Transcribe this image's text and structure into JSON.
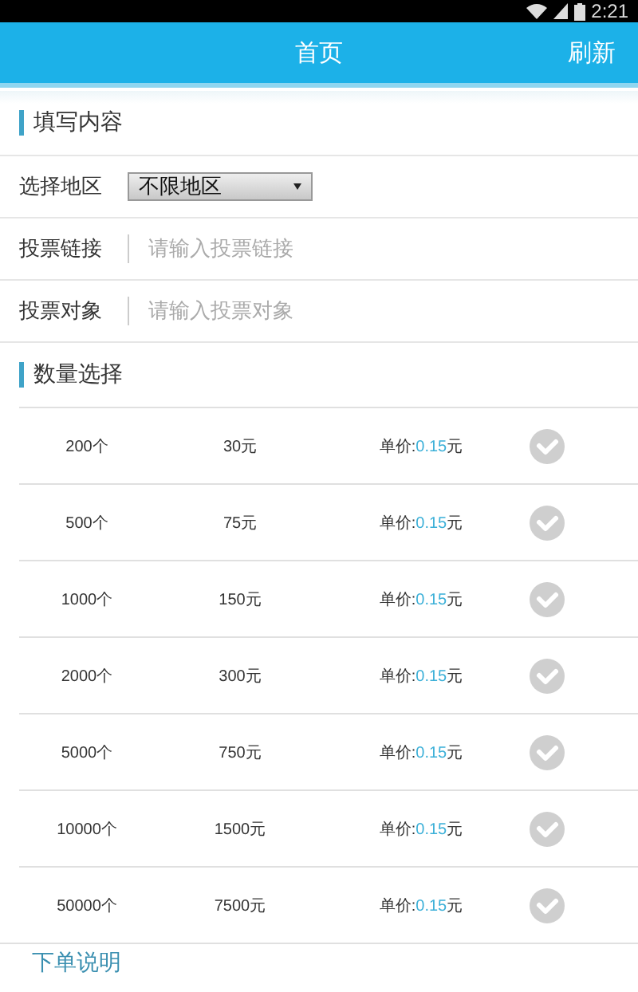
{
  "status_bar": {
    "time": "2:21"
  },
  "app_bar": {
    "title": "首页",
    "action": "刷新"
  },
  "form_section": {
    "title": "填写内容",
    "rows": [
      {
        "kind": "select",
        "label": "选择地区",
        "value": "不限地区"
      },
      {
        "kind": "input",
        "label": "投票链接",
        "placeholder": "请输入投票链接"
      },
      {
        "kind": "input",
        "label": "投票对象",
        "placeholder": "请输入投票对象"
      }
    ]
  },
  "quantity_section": {
    "title": "数量选择",
    "options": [
      {
        "count": "200个",
        "total": "30元",
        "price_label": "单价:",
        "unit_price": "0.15",
        "price_unit": "元",
        "selected": false
      },
      {
        "count": "500个",
        "total": "75元",
        "price_label": "单价:",
        "unit_price": "0.15",
        "price_unit": "元",
        "selected": false
      },
      {
        "count": "1000个",
        "total": "150元",
        "price_label": "单价:",
        "unit_price": "0.15",
        "price_unit": "元",
        "selected": false
      },
      {
        "count": "2000个",
        "total": "300元",
        "price_label": "单价:",
        "unit_price": "0.15",
        "price_unit": "元",
        "selected": false
      },
      {
        "count": "5000个",
        "total": "750元",
        "price_label": "单价:",
        "unit_price": "0.15",
        "price_unit": "元",
        "selected": false
      },
      {
        "count": "10000个",
        "total": "1500元",
        "price_label": "单价:",
        "unit_price": "0.15",
        "price_unit": "元",
        "selected": false
      },
      {
        "count": "50000个",
        "total": "7500元",
        "price_label": "单价:",
        "unit_price": "0.15",
        "price_unit": "元",
        "selected": false
      }
    ]
  },
  "notes_section": {
    "title": "下单说明"
  }
}
